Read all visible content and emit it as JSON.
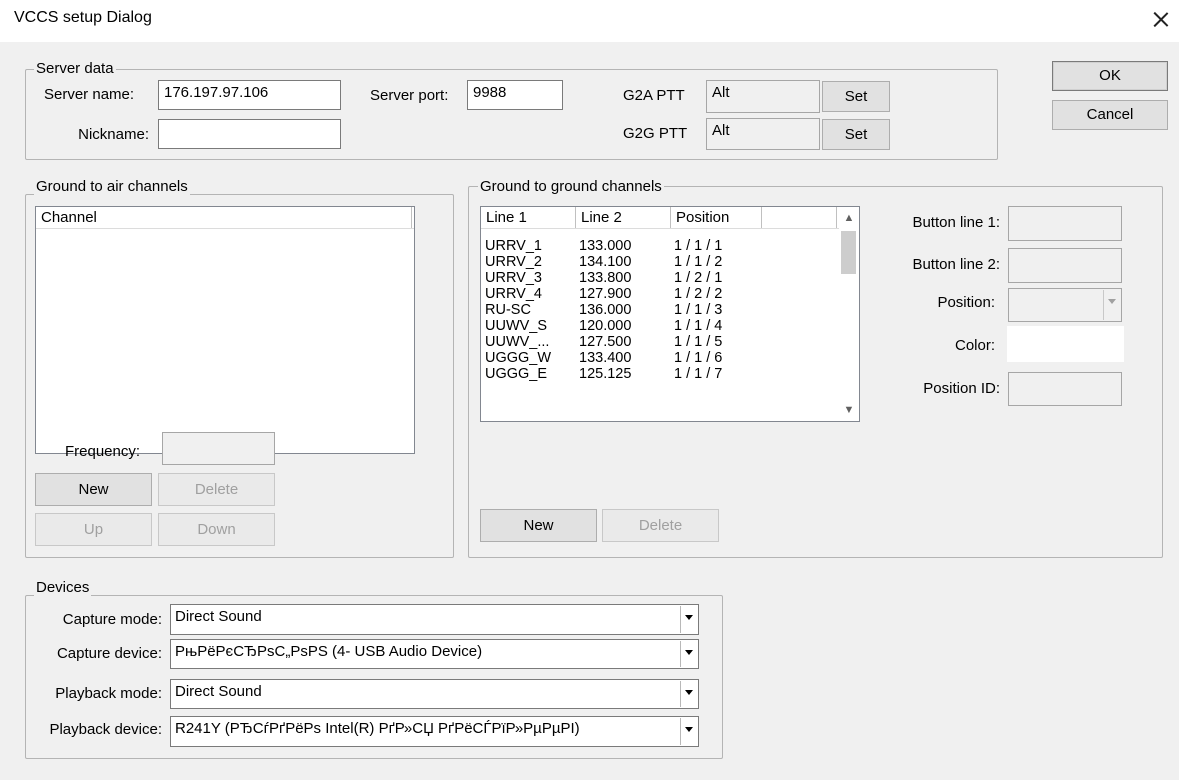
{
  "window": {
    "title": "VCCS setup Dialog"
  },
  "buttons": {
    "ok": "OK",
    "cancel": "Cancel"
  },
  "server": {
    "group_label": "Server data",
    "name_label": "Server name:",
    "name_value": "176.197.97.106",
    "nickname_label": "Nickname:",
    "nickname_value": "",
    "port_label": "Server port:",
    "port_value": "9988",
    "g2a_label": "G2A PTT",
    "g2a_value": "Alt",
    "g2g_label": "G2G PTT",
    "g2g_value": "Alt",
    "set_label": "Set"
  },
  "g2a": {
    "group_label": "Ground to air channels",
    "column": "Channel",
    "frequency_label": "Frequency:",
    "frequency_value": "",
    "new_label": "New",
    "delete_label": "Delete",
    "up_label": "Up",
    "down_label": "Down"
  },
  "g2g": {
    "group_label": "Ground to ground channels",
    "columns": [
      "Line 1",
      "Line 2",
      "Position"
    ],
    "rows": [
      [
        "URRV_1",
        "133.000",
        "1 / 1 / 1"
      ],
      [
        "URRV_2",
        "134.100",
        "1 / 1 / 2"
      ],
      [
        "URRV_3",
        "133.800",
        "1 / 2 / 1"
      ],
      [
        "URRV_4",
        "127.900",
        "1 / 2 / 2"
      ],
      [
        "RU-SC",
        "136.000",
        "1 / 1 / 3"
      ],
      [
        "UUWV_S",
        "120.000",
        "1 / 1 / 4"
      ],
      [
        "UUWV_...",
        "127.500",
        "1 / 1 / 5"
      ],
      [
        "UGGG_W",
        "133.400",
        "1 / 1 / 6"
      ],
      [
        "UGGG_E",
        "125.125",
        "1 / 1 / 7"
      ]
    ],
    "new_label": "New",
    "delete_label": "Delete",
    "button_line1_label": "Button line 1:",
    "button_line2_label": "Button line 2:",
    "position_label": "Position:",
    "color_label": "Color:",
    "position_id_label": "Position ID:",
    "colors": {
      "color_swatch": "#ffffff"
    }
  },
  "devices": {
    "group_label": "Devices",
    "capture_mode_label": "Capture mode:",
    "capture_mode_value": "Direct Sound",
    "capture_device_label": "Capture device:",
    "capture_device_value": "РњРёРєСЂРѕС„РѕРЅ (4- USB Audio Device)",
    "playback_mode_label": "Playback mode:",
    "playback_mode_value": "Direct Sound",
    "playback_device_label": "Playback device:",
    "playback_device_value": "R241Y (РЂСѓРґРёРѕ Intel(R) РґР»СЏ РґРёСЃРїР»РµРµРІ)"
  }
}
